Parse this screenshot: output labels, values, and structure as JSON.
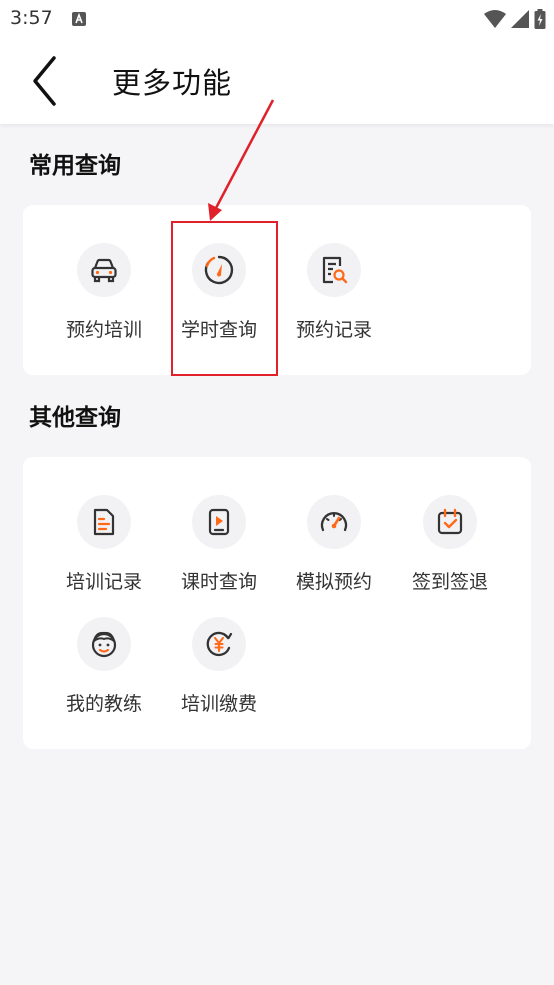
{
  "status_bar": {
    "time": "3:57",
    "icons": [
      "a-notification-icon",
      "wifi-icon",
      "signal-icon",
      "battery-icon"
    ]
  },
  "header": {
    "title": "更多功能",
    "back_icon": "chevron-left-icon"
  },
  "sections": [
    {
      "title": "常用查询",
      "items": [
        {
          "label": "预约培训",
          "icon": "car-icon"
        },
        {
          "label": "学时查询",
          "icon": "speedometer-icon",
          "highlighted": true
        },
        {
          "label": "预约记录",
          "icon": "document-search-icon"
        }
      ]
    },
    {
      "title": "其他查询",
      "items": [
        {
          "label": "培训记录",
          "icon": "document-icon"
        },
        {
          "label": "课时查询",
          "icon": "play-tablet-icon"
        },
        {
          "label": "模拟预约",
          "icon": "gauge-icon"
        },
        {
          "label": "签到签退",
          "icon": "calendar-check-icon"
        },
        {
          "label": "我的教练",
          "icon": "face-icon"
        },
        {
          "label": "培训缴费",
          "icon": "yuan-payment-icon"
        }
      ]
    }
  ],
  "colors": {
    "accent": "#ff6a1a",
    "icon_stroke": "#333333",
    "annotation": "#e0202a",
    "background": "#f5f5f7"
  }
}
